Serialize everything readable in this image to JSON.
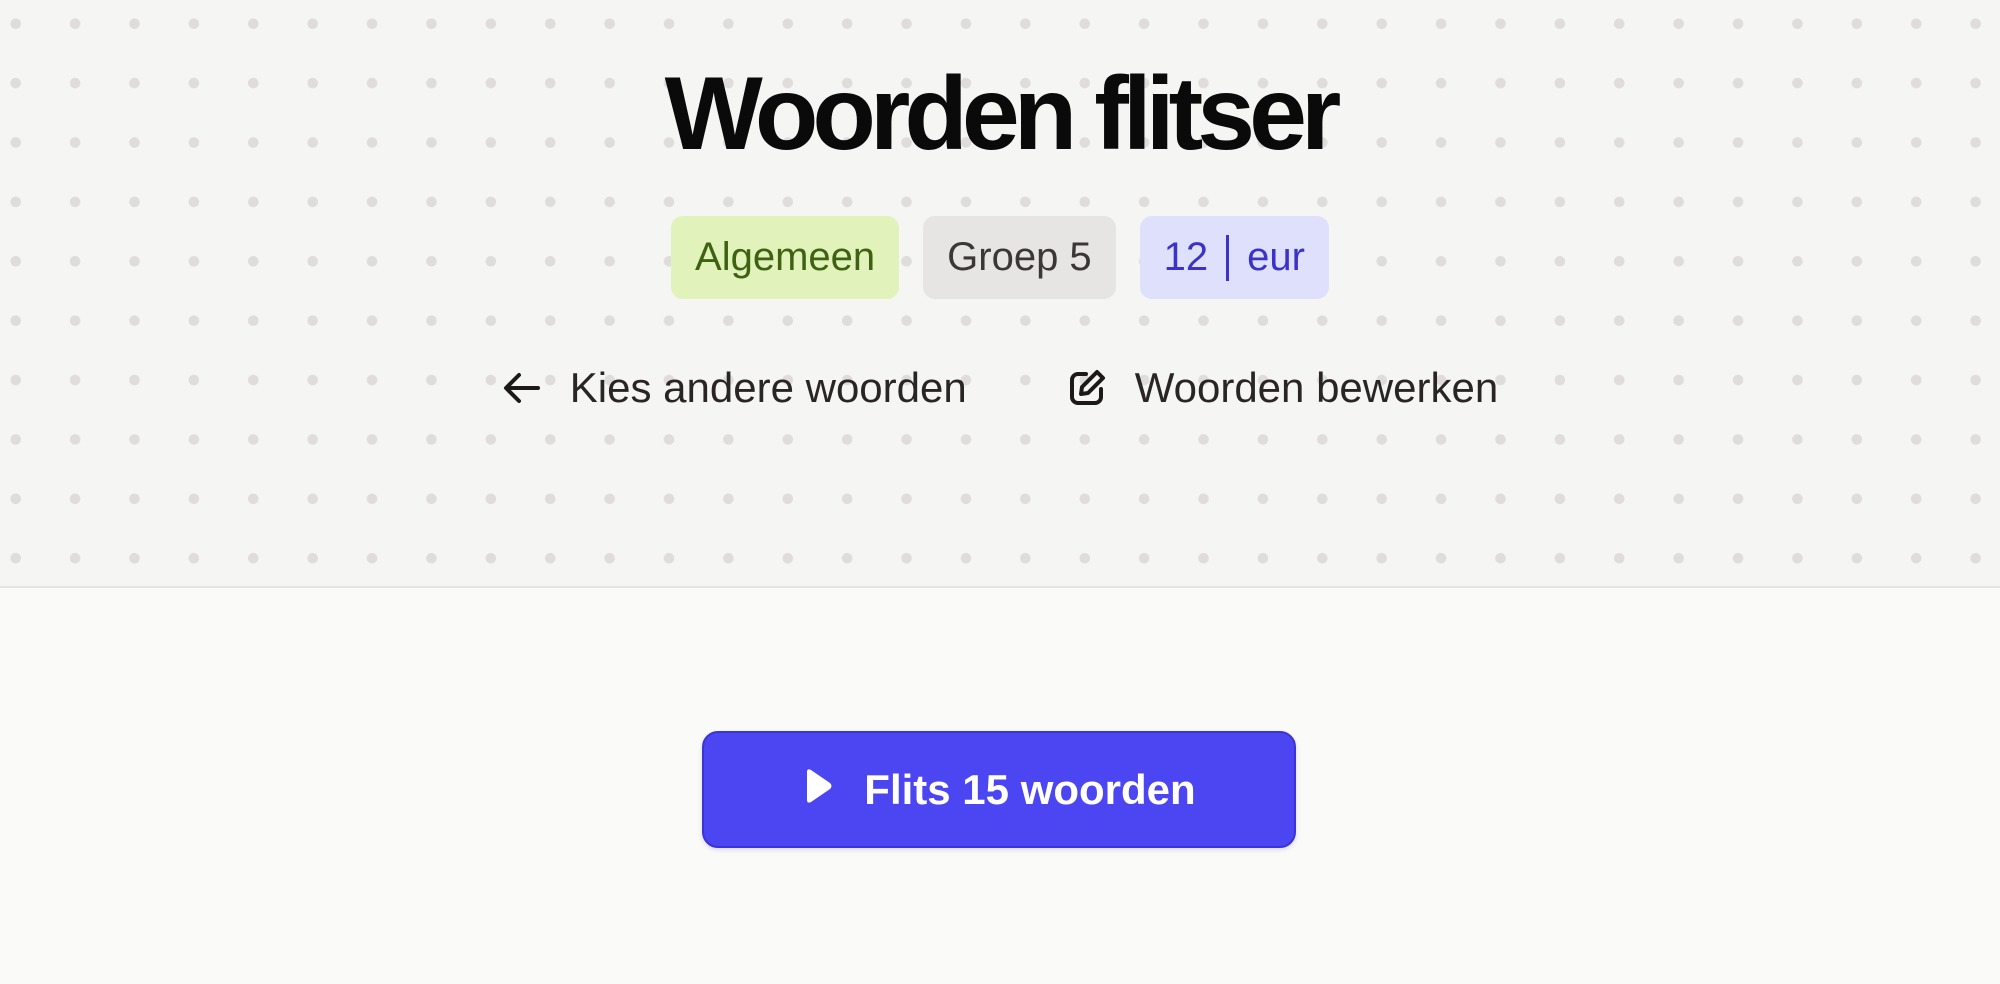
{
  "header": {
    "title": "Woorden flitser",
    "badges": {
      "subject": "Algemeen",
      "group": "Groep 5",
      "list_number": "12",
      "list_name": "eur"
    },
    "nav": {
      "back_label": "Kies andere woorden",
      "edit_label": "Woorden bewerken"
    }
  },
  "main": {
    "start_label": "Flits 15 woorden"
  },
  "icons": {
    "back": "arrow-left-icon",
    "edit": "edit-icon",
    "play": "play-icon"
  },
  "colors": {
    "accent": "#4b46f2",
    "subject_badge_bg": "#e1f2bb",
    "subject_badge_text": "#3f6212",
    "group_badge_bg": "#e7e5e4",
    "list_badge_bg": "#dfe0fb",
    "list_badge_text": "#3b33c9"
  }
}
